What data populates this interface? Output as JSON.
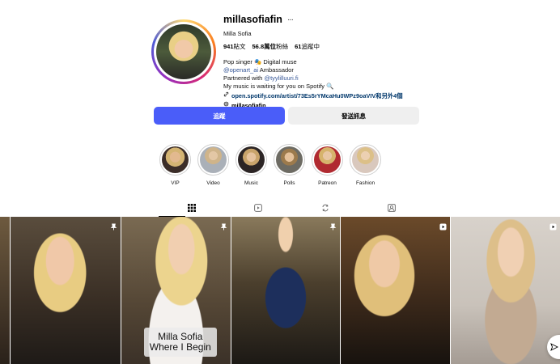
{
  "profile": {
    "username": "millasofiafin",
    "more_icon": "···",
    "full_name": "Milla Sofia",
    "stats": {
      "posts": "941",
      "posts_label": "貼文",
      "followers": "56.8萬位",
      "followers_label": "粉絲",
      "following": "61",
      "following_label": "追蹤中"
    },
    "bio": {
      "line1": "Pop singer 🎭 Digital muse",
      "line2_link": "@openart_ai",
      "line2_text": " Ambassador",
      "line3_text": "Partnered with ",
      "line3_link": "@tyylilluuri.fi",
      "line4": "My music is waiting for you on Spotify 🔍",
      "external_link": "open.spotify.com/artist/73Es5rYMcaHu0WPz9oaVIV和另外4個",
      "threads_handle": "millasofiafin"
    }
  },
  "actions": {
    "follow_label": "追蹤",
    "message_label": "發送訊息"
  },
  "highlights": [
    {
      "label": "VIP"
    },
    {
      "label": "Video"
    },
    {
      "label": "Music"
    },
    {
      "label": "Polls"
    },
    {
      "label": "Patreon"
    },
    {
      "label": "Fashion"
    }
  ],
  "tabs": [
    {
      "icon": "grid-icon",
      "active": true
    },
    {
      "icon": "reels-icon"
    },
    {
      "icon": "repost-icon"
    },
    {
      "icon": "tagged-icon"
    }
  ],
  "posts": [
    {
      "badge": ""
    },
    {
      "badge": "pin-icon"
    },
    {
      "badge": "pin-icon",
      "caption": [
        "Milla Sofia",
        "Where I Begin"
      ]
    },
    {
      "badge": "pin-icon"
    },
    {
      "badge": "reel-icon"
    },
    {
      "badge": "reel-icon"
    }
  ],
  "colors": {
    "follow_button": "#4a5df9",
    "message_button": "#efefef",
    "link": "#385898"
  }
}
